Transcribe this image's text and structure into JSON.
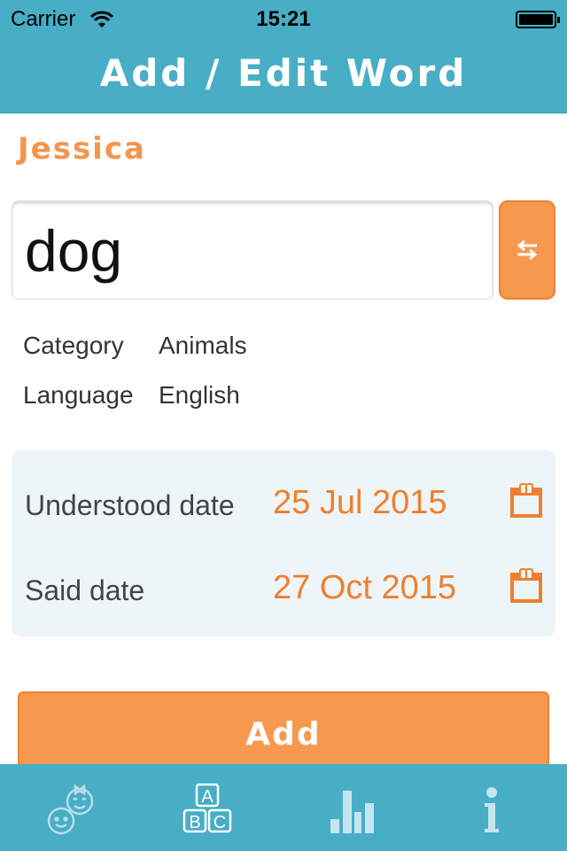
{
  "status_bar": {
    "carrier": "Carrier",
    "time": "15:21"
  },
  "header": {
    "title": "Add / Edit Word"
  },
  "child_name": "Jessica",
  "word": {
    "value": "dog"
  },
  "meta": {
    "category_label": "Category",
    "category_value": "Animals",
    "language_label": "Language",
    "language_value": "English"
  },
  "dates": {
    "understood_label": "Understood date",
    "understood_value": "25 Jul 2015",
    "said_label": "Said date",
    "said_value": "27 Oct 2015"
  },
  "add_button": "Add",
  "tabs": [
    {
      "icon": "children-icon",
      "active": false
    },
    {
      "icon": "abc-blocks-icon",
      "active": true
    },
    {
      "icon": "bar-chart-icon",
      "active": false
    },
    {
      "icon": "info-icon",
      "active": false
    }
  ],
  "colors": {
    "header": "#47aec6",
    "accent": "#f7984f",
    "date_text": "#ee7f2f"
  }
}
